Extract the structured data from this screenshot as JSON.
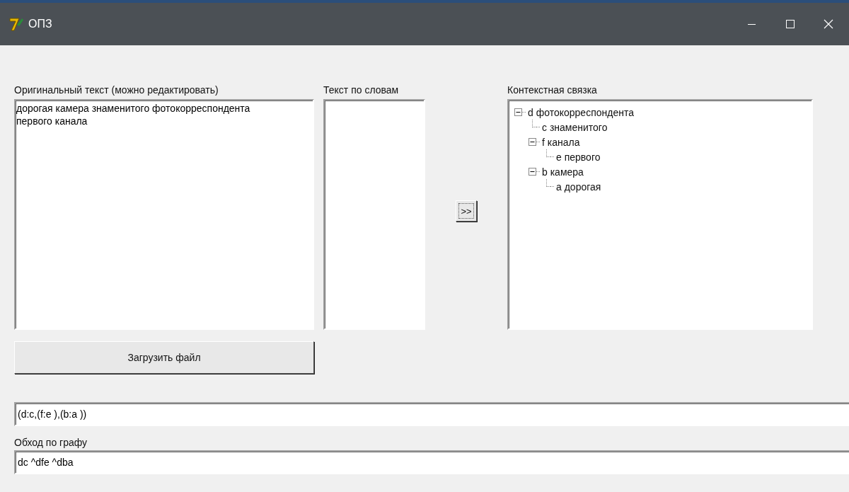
{
  "window": {
    "title": "ОПЗ"
  },
  "original_text": {
    "label": "Оригинальный текст (можно редактировать)",
    "value": "дорогая камера знаменитого фотокорреспондента\nпервого канала"
  },
  "words": {
    "label": "Текст по словам"
  },
  "convert_button": {
    "label": ">>"
  },
  "context": {
    "label": "Контекстная связка",
    "tree": [
      {
        "label": "d фотокорреспондента",
        "expanded": true,
        "children": [
          {
            "label": "c знаменитого"
          },
          {
            "label": "f канала",
            "expanded": true,
            "children": [
              {
                "label": "e первого"
              }
            ]
          },
          {
            "label": "b камера",
            "expanded": true,
            "children": [
              {
                "label": "a дорогая"
              }
            ]
          }
        ]
      }
    ]
  },
  "load_button": {
    "label": "Загрузить файл"
  },
  "structure_field": {
    "value": "(d:c,(f:e ),(b:a ))"
  },
  "traversal": {
    "label": "Обход по графу",
    "value": "dc ^dfe ^dba"
  }
}
